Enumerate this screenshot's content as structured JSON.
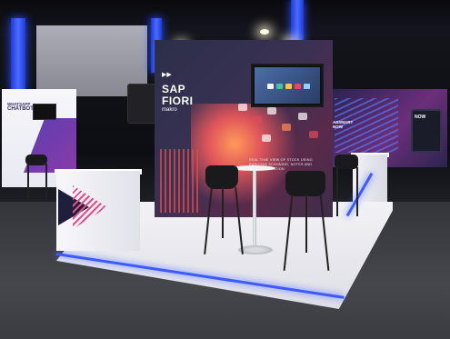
{
  "booth": {
    "title_line1": "SAP",
    "title_line2": "FIORI",
    "brand": "makro",
    "small_print_1": "REAL TIME VIEW OF STOCK USING",
    "small_print_2": "BARCODE SCANNING, NOTES AND",
    "small_print_3": "LEAD GENERATION"
  },
  "left_booth": {
    "line1": "WHATSAPP",
    "line2": "CHATBOT"
  },
  "right_booth": {
    "line1": "ASSMART",
    "line2": "NOW",
    "screen_text": "NOW"
  },
  "colors": {
    "led": "#3c5bff",
    "accent_red": "#e24a4a",
    "accent_purple": "#6a2f7a"
  }
}
